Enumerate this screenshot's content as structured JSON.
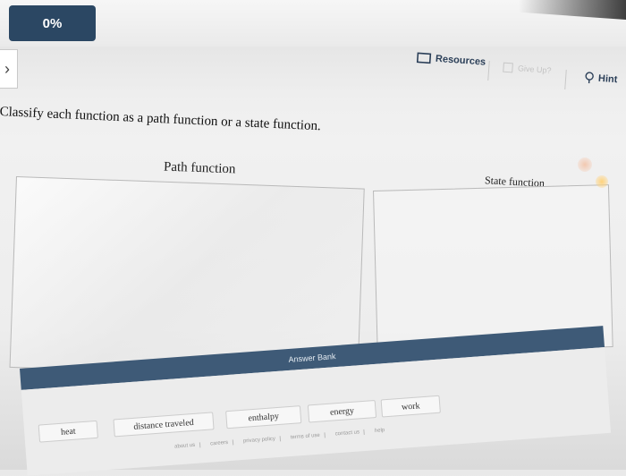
{
  "header": {
    "progress_label": "0%"
  },
  "toolbar": {
    "back_icon": "chevron-right-icon",
    "resources_label": "Resources",
    "giveup_label": "Give Up?",
    "hint_label": "Hint",
    "colors": {
      "accent": "#2b4763",
      "bank_header": "#3e5a77"
    }
  },
  "question": {
    "prompt": "Classify each function as a path function or a state function."
  },
  "zones": {
    "path_label": "Path function",
    "state_label": "State function"
  },
  "answer_bank": {
    "title": "Answer Bank",
    "items": [
      "heat",
      "distance traveled",
      "enthalpy",
      "energy",
      "work"
    ]
  },
  "footer": {
    "links": [
      "about us",
      "careers",
      "privacy policy",
      "terms of use",
      "contact us",
      "help"
    ]
  }
}
